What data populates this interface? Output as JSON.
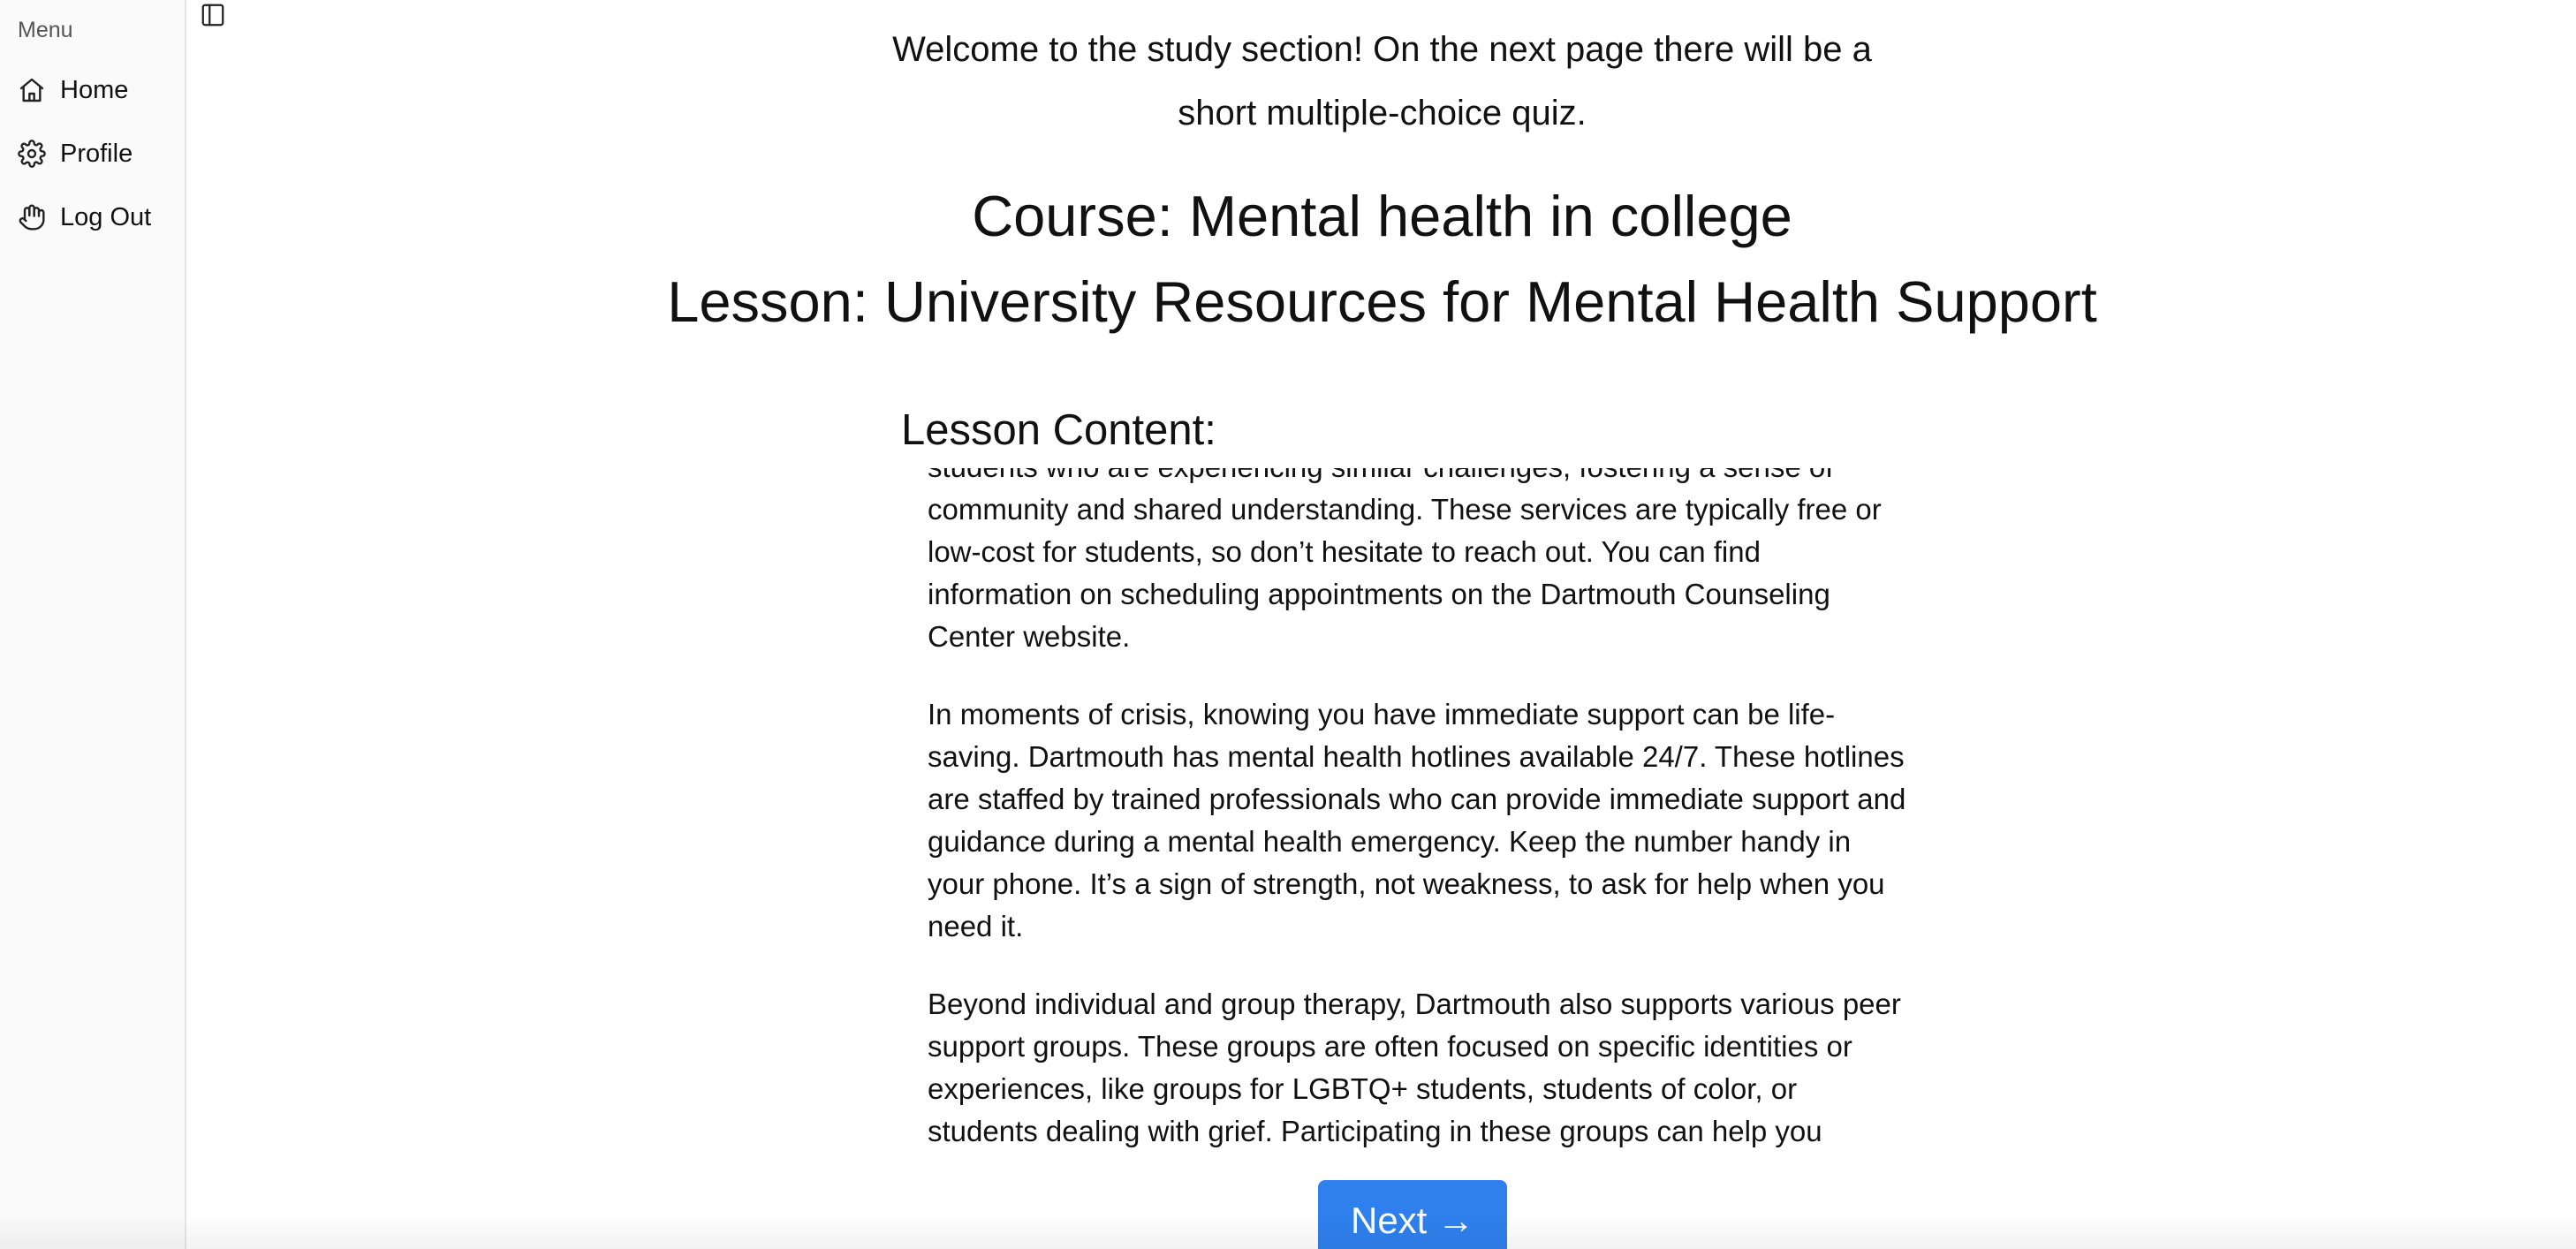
{
  "sidebar": {
    "heading": "Menu",
    "items": [
      {
        "label": "Home",
        "icon": "home-icon"
      },
      {
        "label": "Profile",
        "icon": "gear-icon"
      },
      {
        "label": "Log Out",
        "icon": "hand-icon"
      }
    ]
  },
  "intro": {
    "line1": "Welcome to the study section! On the next page there will be a",
    "line2": "short multiple-choice quiz."
  },
  "course_title": "Course: Mental health in college",
  "lesson_title": "Lesson: University Resources for Mental Health Support",
  "lesson_content": {
    "heading": "Lesson Content:",
    "paragraphs": [
      "students who are experiencing similar challenges, fostering a sense of community and shared understanding. These services are typically free or low-cost for students, so don’t hesitate to reach out. You can find information on scheduling appointments on the Dartmouth Counseling Center website.",
      "In moments of crisis, knowing you have immediate support can be life-saving. Dartmouth has mental health hotlines available 24/7. These hotlines are staffed by trained professionals who can provide immediate support and guidance during a mental health emergency. Keep the number handy in your phone. It’s a sign of strength, not weakness, to ask for help when you need it.",
      "Beyond individual and group therapy, Dartmouth also supports various peer support groups. These groups are often focused on specific identities or experiences, like groups for LGBTQ+ students, students of color, or students dealing with grief. Participating in these groups can help you connect with others who understand what you’re going through and build a strong support network."
    ]
  },
  "next_button": {
    "label": "Next →"
  },
  "colors": {
    "accent": "#2f80ed",
    "sidebar_bg": "#fafafa",
    "text": "#111111"
  }
}
